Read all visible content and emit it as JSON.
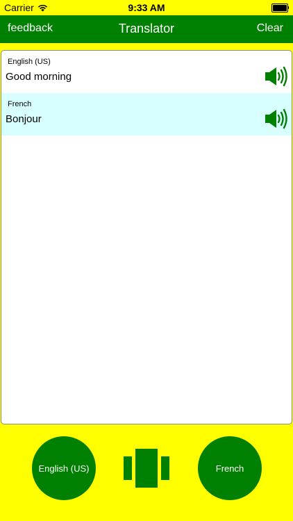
{
  "status_bar": {
    "carrier": "Carrier",
    "time": "9:33 AM",
    "battery_level": 1.0
  },
  "nav_bar": {
    "left_button": "feedback",
    "title": "Translator",
    "right_button": "Clear"
  },
  "translations": [
    {
      "language": "English (US)",
      "text": "Good morning",
      "icon": "speaker-icon"
    },
    {
      "language": "French",
      "text": "Bonjour",
      "icon": "speaker-icon"
    }
  ],
  "bottom": {
    "left_language": "English (US)",
    "right_language": "French",
    "swap_icon": "swap-icon"
  },
  "colors": {
    "background": "#ffff00",
    "primary_green": "#008000",
    "alt_row": "#d8ffff",
    "text": "#000000",
    "white": "#ffffff"
  }
}
